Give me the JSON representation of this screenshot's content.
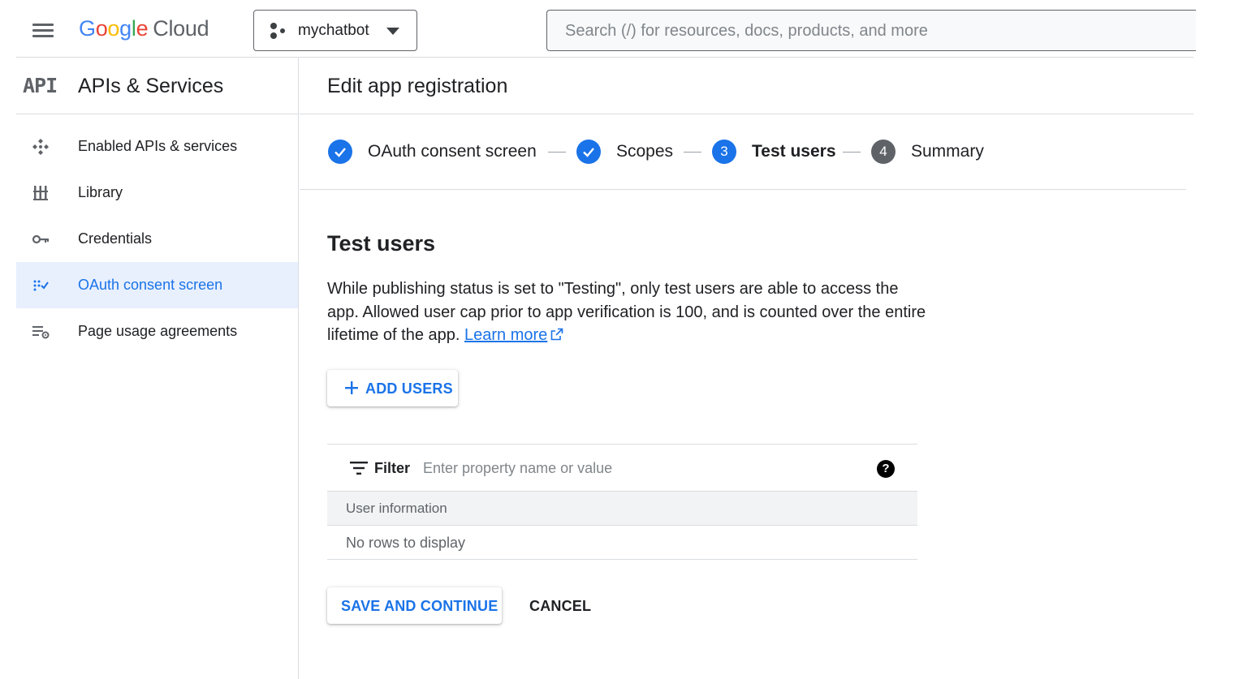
{
  "header": {
    "logo": {
      "g1": "G",
      "o1": "o",
      "o2": "o",
      "g2": "g",
      "l": "l",
      "e": "e",
      "cloud": "Cloud"
    },
    "project": "mychatbot",
    "search_placeholder": "Search (/) for resources, docs, products, and more"
  },
  "sidebar": {
    "badge": "API",
    "title": "APIs & Services",
    "items": [
      {
        "label": "Enabled APIs & services",
        "icon": "enabled-apis-icon",
        "active": false
      },
      {
        "label": "Library",
        "icon": "library-icon",
        "active": false
      },
      {
        "label": "Credentials",
        "icon": "key-icon",
        "active": false
      },
      {
        "label": "OAuth consent screen",
        "icon": "oauth-consent-icon",
        "active": true
      },
      {
        "label": "Page usage agreements",
        "icon": "page-usage-settings-icon",
        "active": false
      }
    ]
  },
  "main": {
    "page_title": "Edit app registration",
    "steps": [
      {
        "label": "OAuth consent screen",
        "state": "done",
        "number": ""
      },
      {
        "label": "Scopes",
        "state": "done",
        "number": ""
      },
      {
        "label": "Test users",
        "state": "current",
        "number": "3"
      },
      {
        "label": "Summary",
        "state": "todo",
        "number": "4"
      }
    ],
    "section_title": "Test users",
    "description": "While publishing status is set to \"Testing\", only test users are able to access the app. Allowed user cap prior to app verification is 100, and is counted over the entire lifetime of the app.",
    "learn_more": "Learn more",
    "add_users_label": "ADD USERS",
    "table": {
      "filter_label": "Filter",
      "filter_placeholder": "Enter property name or value",
      "help": "?",
      "column_header": "User information",
      "empty_message": "No rows to display"
    },
    "save_label": "SAVE AND CONTINUE",
    "cancel_label": "CANCEL"
  },
  "colors": {
    "accent": "#1a73e8",
    "active_bg": "#e8f0fe",
    "text": "#202124",
    "muted": "#5f6368",
    "divider": "#dadce0"
  }
}
